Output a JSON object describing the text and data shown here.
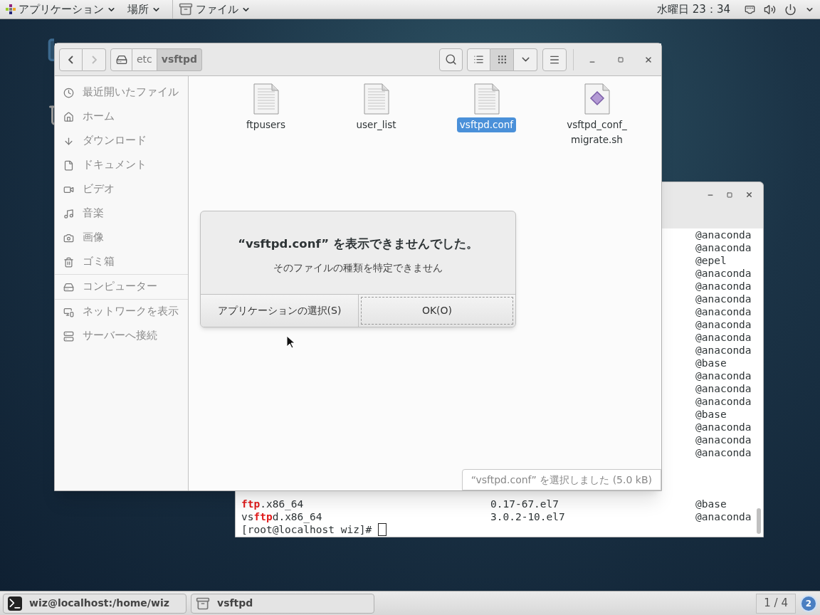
{
  "top_bar": {
    "menus": [
      {
        "label": "アプリケーション",
        "kind": "apps"
      },
      {
        "label": "場所",
        "kind": "places"
      },
      {
        "label": "ファイル",
        "kind": "app"
      }
    ],
    "clock": "水曜日 23：34"
  },
  "desktop_icons": [
    {
      "kind": "folder"
    },
    {
      "kind": "trash"
    }
  ],
  "terminal": {
    "lines": [
      {
        "kind": "output",
        "repo": "@anaconda"
      },
      {
        "kind": "output",
        "repo": "@anaconda"
      },
      {
        "kind": "output",
        "repo": "@epel"
      },
      {
        "kind": "output",
        "repo": "@anaconda"
      },
      {
        "kind": "output",
        "repo": "@anaconda"
      },
      {
        "kind": "output",
        "repo": "@anaconda"
      },
      {
        "kind": "output",
        "repo": "@anaconda"
      },
      {
        "kind": "output",
        "repo": "@anaconda"
      },
      {
        "kind": "output",
        "repo": "@anaconda"
      },
      {
        "kind": "output",
        "repo": "@anaconda"
      },
      {
        "kind": "output",
        "repo": "@base"
      },
      {
        "kind": "output",
        "repo": "@anaconda"
      },
      {
        "kind": "output",
        "repo": "@anaconda"
      },
      {
        "kind": "output",
        "repo": "@anaconda"
      },
      {
        "kind": "output",
        "repo": "@base"
      },
      {
        "kind": "output",
        "repo": "@anaconda"
      },
      {
        "kind": "output",
        "repo": "@anaconda"
      },
      {
        "kind": "output",
        "repo": "@anaconda"
      },
      {
        "kind": "blank"
      },
      {
        "kind": "blank"
      },
      {
        "kind": "blank"
      },
      {
        "kind": "output",
        "name": [
          {
            "text": "ftp",
            "match": true
          },
          {
            "text": ".x86_64",
            "match": false
          }
        ],
        "version": "0.17-67.el7",
        "repo": "@base"
      },
      {
        "kind": "output",
        "name": [
          {
            "text": "vs",
            "match": false
          },
          {
            "text": "ftp",
            "match": true
          },
          {
            "text": "d.x86_64",
            "match": false
          }
        ],
        "version": "3.0.2-10.el7",
        "repo": "@anaconda"
      },
      {
        "kind": "prompt",
        "text": "[root@localhost wiz]#"
      }
    ]
  },
  "file_manager": {
    "navigation": {
      "back": {
        "disabled": false
      },
      "forward": {
        "disabled": true
      }
    },
    "path": [
      {
        "label": "etc",
        "selected": false
      },
      {
        "label": "vsftpd",
        "selected": true
      }
    ],
    "views": [
      {
        "kind": "list",
        "selected": false
      },
      {
        "kind": "grid",
        "selected": true
      }
    ],
    "sidebar": [
      [
        {
          "label": "最近開いたファイル",
          "kind": "recent"
        },
        {
          "label": "ホーム",
          "kind": "home"
        },
        {
          "label": "ダウンロード",
          "kind": "download"
        },
        {
          "label": "ドキュメント",
          "kind": "document"
        },
        {
          "label": "ビデオ",
          "kind": "video"
        },
        {
          "label": "音楽",
          "kind": "music"
        },
        {
          "label": "画像",
          "kind": "picture"
        },
        {
          "label": "ゴミ箱",
          "kind": "trash"
        }
      ],
      [
        {
          "label": "コンピューター",
          "kind": "computer"
        }
      ],
      [
        {
          "label": "ネットワークを表示",
          "kind": "network"
        },
        {
          "label": "サーバーへ接続",
          "kind": "server"
        }
      ]
    ],
    "files": [
      {
        "name": "ftpusers",
        "kind": "text",
        "selected": false
      },
      {
        "name": "user_list",
        "kind": "text",
        "selected": false
      },
      {
        "name": "vsftpd.conf",
        "kind": "text",
        "selected": true
      },
      {
        "name": "vsftpd_conf_migrate.sh",
        "kind": "script",
        "selected": false
      }
    ],
    "status": "“vsftpd.conf” を選択しました (5.0 kB)"
  },
  "dialog": {
    "title": "“vsftpd.conf” を表示できませんでした。",
    "message": "そのファイルの種類を特定できません",
    "buttons": [
      {
        "label": "アプリケーションの選択(S)",
        "focused": false
      },
      {
        "label": "OK(O)",
        "focused": true
      }
    ]
  },
  "taskbar": {
    "tasks": [
      {
        "label": "wiz@localhost:/home/wiz",
        "kind": "terminal"
      },
      {
        "label": "vsftpd",
        "kind": "files"
      }
    ],
    "workspace": "1 / 4",
    "notifications": "2"
  }
}
